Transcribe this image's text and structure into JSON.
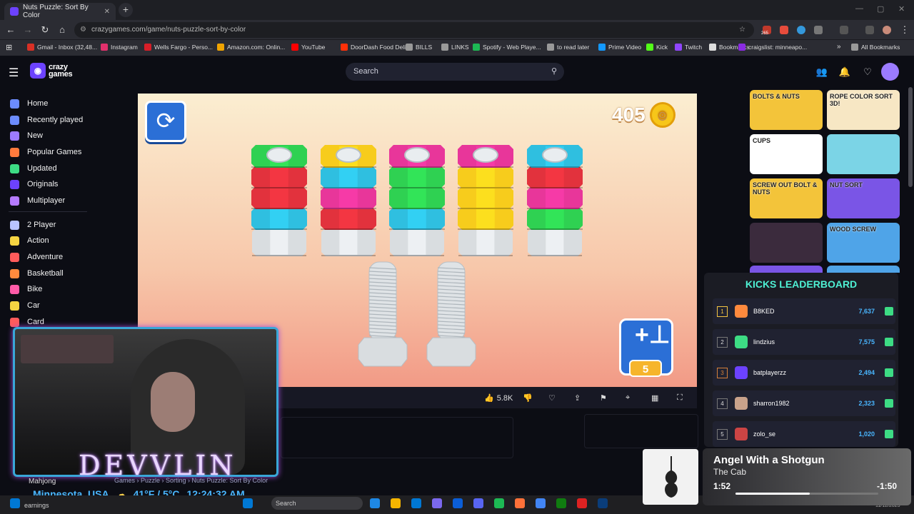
{
  "browser": {
    "tab_title": "Nuts Puzzle: Sort By Color",
    "new_tab": "+",
    "url": "crazygames.com/game/nuts-puzzle-sort-by-color",
    "badge_count": "265",
    "bookmarks": [
      {
        "label": "Gmail - Inbox (32,48...",
        "color": "#d93025"
      },
      {
        "label": "Instagram",
        "color": "#e1306c"
      },
      {
        "label": "Wells Fargo - Perso...",
        "color": "#d71e28"
      },
      {
        "label": "Amazon.com: Onlin...",
        "color": "#f0a400"
      },
      {
        "label": "YouTube",
        "color": "#ff0000"
      },
      {
        "label": "DoorDash Food Deli...",
        "color": "#ff3008"
      },
      {
        "label": "BILLS",
        "color": "#999999"
      },
      {
        "label": "LINKS",
        "color": "#999999"
      },
      {
        "label": "Spotify - Web Playe...",
        "color": "#1db954"
      },
      {
        "label": "to read later",
        "color": "#999999"
      },
      {
        "label": "Prime Video",
        "color": "#1399ff"
      },
      {
        "label": "Kick",
        "color": "#53fc18"
      },
      {
        "label": "Twitch",
        "color": "#9146ff"
      },
      {
        "label": "Bookmarks",
        "color": "#dddddd"
      },
      {
        "label": "craigslist: minneapo...",
        "color": "#8a2be2"
      }
    ],
    "all_bookmarks": "All Bookmarks"
  },
  "site": {
    "logo_top": "crazy",
    "logo_bottom": "games",
    "search_placeholder": "Search",
    "sidebar": [
      {
        "label": "Home",
        "color": "#6c8cff"
      },
      {
        "label": "Recently played",
        "color": "#6c8cff"
      },
      {
        "label": "New",
        "color": "#9d7bff"
      },
      {
        "label": "Popular Games",
        "color": "#ff7a3d"
      },
      {
        "label": "Updated",
        "color": "#3ddc84"
      },
      {
        "label": "Originals",
        "color": "#6c42ff"
      },
      {
        "label": "Multiplayer",
        "color": "#b57bff"
      },
      {
        "label": "2 Player",
        "color": "#b9c3ff"
      },
      {
        "label": "Action",
        "color": "#f5d442"
      },
      {
        "label": "Adventure",
        "color": "#ff5b5b"
      },
      {
        "label": "Basketball",
        "color": "#ff8a3d"
      },
      {
        "label": "Bike",
        "color": "#ff5ba8"
      },
      {
        "label": "Car",
        "color": "#f5d442"
      },
      {
        "label": "Card",
        "color": "#ff5b5b"
      },
      {
        "label": "Mahjong",
        "color": "#8ec7ff"
      }
    ]
  },
  "game": {
    "coins": "405",
    "add_bolt_count": "5",
    "likes": "5.8K",
    "bolts": [
      [
        "#2fd152",
        "#e2323d",
        "#e2323d",
        "#2fbfe0"
      ],
      [
        "#f7cc1c",
        "#2fbfe0",
        "#e8369a",
        "#e2323d"
      ],
      [
        "#e8369a",
        "#2fd152",
        "#2fd152",
        "#2fbfe0"
      ],
      [
        "#e8369a",
        "#f7cc1c",
        "#f7cc1c",
        "#f7cc1c"
      ],
      [
        "#2fbfe0",
        "#e2323d",
        "#e8369a",
        "#2fd152"
      ]
    ],
    "empty_bolts": 2
  },
  "right_thumbs": [
    {
      "title": "BOLTS & NUTS",
      "bg": "#f3c43a"
    },
    {
      "title": "ROPE COLOR SORT 3D!",
      "bg": "#f7e7c4"
    },
    {
      "title": "CUPS",
      "bg": "#ffffff"
    },
    {
      "title": "",
      "bg": "#7bd4e6"
    },
    {
      "title": "SCREW OUT BOLT & NUTS",
      "bg": "#f3c43a"
    },
    {
      "title": "NUT SORT",
      "bg": "#7a55e6"
    },
    {
      "title": "",
      "bg": "#3b2b3d"
    },
    {
      "title": "WOOD SCREW",
      "bg": "#4fa4e8"
    }
  ],
  "leaderboard": {
    "title": "KICKS LEADERBOARD",
    "rows": [
      {
        "rank": "1",
        "name": "B8KED",
        "score": "7,637",
        "color": "#ff8a3d"
      },
      {
        "rank": "2",
        "name": "lindzius",
        "score": "7,575",
        "color": "#3ddc84"
      },
      {
        "rank": "3",
        "name": "batplayerzz",
        "score": "2,494",
        "color": "#6c42ff"
      },
      {
        "rank": "4",
        "name": "sharron1982",
        "score": "2,323",
        "color": "#c8a28b"
      },
      {
        "rank": "5",
        "name": "zolo_se",
        "score": "1,020",
        "color": "#cc4444"
      }
    ]
  },
  "stream": {
    "name": "DEVVLIN",
    "location": "Minnesota, USA",
    "weather": "41°F / 5°C",
    "time": "12:24:32 AM",
    "breadcrumb": "Games  ›  Puzzle  ›  Sorting  ›  Nuts Puzzle: Sort By Color",
    "sidebar_tail": "Mahjong"
  },
  "music": {
    "title": "Angel With a Shotgun",
    "artist": "The Cab",
    "current": "1:52",
    "remaining": "-1:50",
    "progress": 0.52
  },
  "taskbar": {
    "search": "Search",
    "corner": "earnings",
    "date": "11/12/2025"
  }
}
